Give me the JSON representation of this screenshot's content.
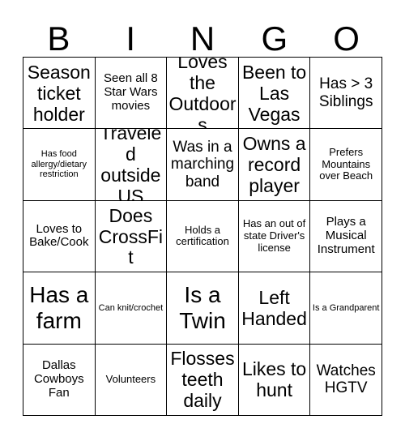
{
  "card": {
    "title": "BINGO",
    "header_letters": [
      "B",
      "I",
      "N",
      "G",
      "O"
    ],
    "columns": 5,
    "rows": 5,
    "colors": {
      "background": "#ffffff",
      "text": "#000000",
      "grid_line": "#000000"
    },
    "cells": [
      {
        "text": "Season ticket holder",
        "size": "fs-lg"
      },
      {
        "text": "Seen all 8 Star Wars movies",
        "size": "fs-sm"
      },
      {
        "text": "Loves the Outdoors",
        "size": "fs-lg"
      },
      {
        "text": "Been to Las Vegas",
        "size": "fs-lg"
      },
      {
        "text": "Has > 3 Siblings",
        "size": "fs-md"
      },
      {
        "text": "Has food allergy/dietary restriction",
        "size": "fs-xxs"
      },
      {
        "text": "Traveled outside US",
        "size": "fs-lg"
      },
      {
        "text": "Was in a marching band",
        "size": "fs-md"
      },
      {
        "text": "Owns a record player",
        "size": "fs-lg"
      },
      {
        "text": "Prefers Mountains over Beach",
        "size": "fs-xs"
      },
      {
        "text": "Loves to Bake/Cook",
        "size": "fs-sm"
      },
      {
        "text": "Does CrossFit",
        "size": "fs-lg"
      },
      {
        "text": "Holds a certification",
        "size": "fs-xs"
      },
      {
        "text": "Has an out of state Driver's license",
        "size": "fs-xs"
      },
      {
        "text": "Plays a Musical Instrument",
        "size": "fs-sm"
      },
      {
        "text": "Has a farm",
        "size": "fs-xl"
      },
      {
        "text": "Can knit/crochet",
        "size": "fs-xxs"
      },
      {
        "text": "Is a Twin",
        "size": "fs-xl"
      },
      {
        "text": "Left Handed",
        "size": "fs-lg"
      },
      {
        "text": "Is a Grandparent",
        "size": "fs-xxs"
      },
      {
        "text": "Dallas Cowboys Fan",
        "size": "fs-sm"
      },
      {
        "text": "Volunteers",
        "size": "fs-xs"
      },
      {
        "text": "Flosses teeth daily",
        "size": "fs-lg"
      },
      {
        "text": "Likes to hunt",
        "size": "fs-lg"
      },
      {
        "text": "Watches HGTV",
        "size": "fs-md"
      }
    ]
  }
}
